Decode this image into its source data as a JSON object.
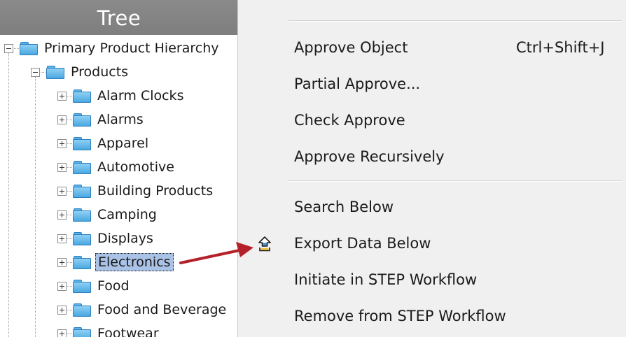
{
  "tree": {
    "header": "Tree",
    "root": "Primary Product Hierarchy",
    "products": "Products",
    "items": [
      "Alarm Clocks",
      "Alarms",
      "Apparel",
      "Automotive",
      "Building Products",
      "Camping",
      "Displays",
      "Electronics",
      "Food",
      "Food and Beverage",
      "Footwear"
    ],
    "selected_item": "Electronics"
  },
  "menu": {
    "items": [
      {
        "label": "Approve Object",
        "shortcut": "Ctrl+Shift+J"
      },
      {
        "label": "Partial Approve..."
      },
      {
        "label": "Check Approve"
      },
      {
        "label": "Approve Recursively"
      },
      {
        "label": "Search Below"
      },
      {
        "label": "Export Data Below",
        "icon": "export-up-arrow-icon"
      },
      {
        "label": "Initiate in STEP Workflow"
      },
      {
        "label": "Remove from STEP Workflow"
      }
    ]
  },
  "colors": {
    "header_bg": "#848484",
    "selection_bg": "#a9c2e6",
    "menu_bg": "#f0f0f0",
    "arrow": "#b5212b",
    "folder": "#4aa8e0"
  }
}
